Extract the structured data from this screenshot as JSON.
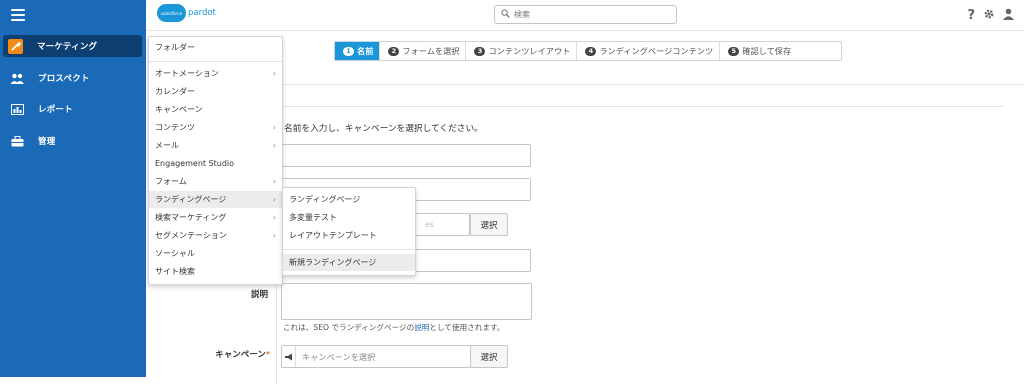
{
  "sidebar": {
    "items": [
      {
        "label": "マーケティング",
        "icon": "wrench-icon"
      },
      {
        "label": "プロスペクト",
        "icon": "people-icon"
      },
      {
        "label": "レポート",
        "icon": "chart-icon"
      },
      {
        "label": "管理",
        "icon": "briefcase-icon"
      }
    ],
    "accent_color": "#f28a1b"
  },
  "header": {
    "logo_cloud": "salesforce",
    "logo_text": "pardot",
    "search_placeholder": "検索",
    "help_icon": "?"
  },
  "wizard": {
    "steps": [
      {
        "num": "1",
        "label": "名前",
        "active": true
      },
      {
        "num": "2",
        "label": "フォームを選択",
        "active": false
      },
      {
        "num": "3",
        "label": "コンテンツレイアウト",
        "active": false
      },
      {
        "num": "4",
        "label": "ランディングページコンテンツ",
        "active": false
      },
      {
        "num": "5",
        "label": "確認して保存",
        "active": false
      }
    ]
  },
  "form": {
    "instruction": "名前を入力し、キャンペーンを選択してください。",
    "folder_ghost": "es",
    "select_label": "選択",
    "description_label": "説明",
    "description_hint_prefix": "これは、SEO でランディングページの",
    "description_hint_link": "説明",
    "description_hint_suffix": "として使用されます。",
    "campaign_label": "キャンペーン",
    "campaign_placeholder": "キャンペーンを選択",
    "campaign_select": "選択"
  },
  "menu": {
    "items": [
      {
        "label": "フォルダー",
        "has_sub": false
      },
      {
        "label": "オートメーション",
        "has_sub": true
      },
      {
        "label": "カレンダー",
        "has_sub": false
      },
      {
        "label": "キャンペーン",
        "has_sub": false
      },
      {
        "label": "コンテンツ",
        "has_sub": true
      },
      {
        "label": "メール",
        "has_sub": true
      },
      {
        "label": "Engagement Studio",
        "has_sub": false
      },
      {
        "label": "フォーム",
        "has_sub": true
      },
      {
        "label": "ランディングページ",
        "has_sub": true
      },
      {
        "label": "検索マーケティング",
        "has_sub": true
      },
      {
        "label": "セグメンテーション",
        "has_sub": true
      },
      {
        "label": "ソーシャル",
        "has_sub": false
      },
      {
        "label": "サイト検索",
        "has_sub": false
      }
    ]
  },
  "submenu": {
    "items": [
      {
        "label": "ランディングページ"
      },
      {
        "label": "多変量テスト"
      },
      {
        "label": "レイアウトテンプレート"
      },
      {
        "label": "新規ランディングページ"
      }
    ]
  }
}
